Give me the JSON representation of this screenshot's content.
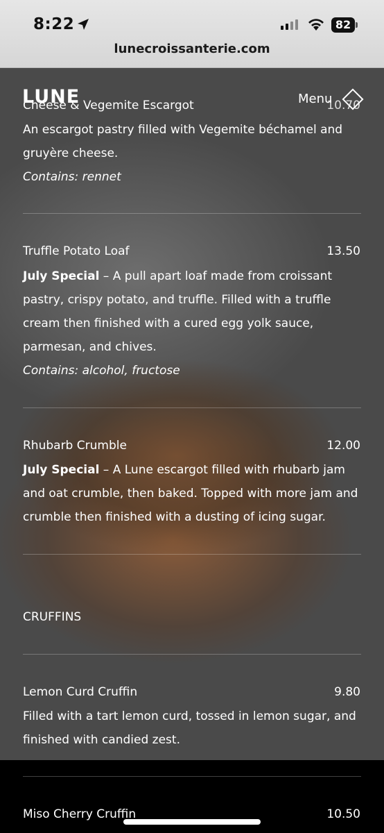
{
  "status_bar": {
    "time": "8:22",
    "battery": "82",
    "url": "lunecroissanterie.com"
  },
  "header": {
    "logo": "LUNE",
    "menu_label": "Menu"
  },
  "items": [
    {
      "name": "Cheese & Vegemite Escargot",
      "price": "10.70",
      "special": "",
      "description": "An escargot pastry filled with Vegemite béchamel and gruyère cheese.",
      "contains": "Contains: rennet"
    },
    {
      "name": "Truffle Potato Loaf",
      "price": "13.50",
      "special": "July Special",
      "description": " – A pull apart loaf made from croissant pastry, crispy potato, and truffle. Filled with a truffle cream then finished with a cured egg yolk sauce, parmesan, and chives.",
      "contains": "Contains: alcohol, fructose"
    },
    {
      "name": "Rhubarb Crumble",
      "price": "12.00",
      "special": "July Special",
      "description": " – A Lune escargot filled with rhubarb jam and oat crumble, then baked. Topped with more jam and crumble then finished with a dusting of icing sugar.",
      "contains": ""
    },
    {
      "name": "Lemon Curd Cruffin",
      "price": "9.80",
      "special": "",
      "description": "Filled with a tart lemon curd, tossed in lemon sugar, and finished with candied zest.",
      "contains": ""
    },
    {
      "name": "Miso Cherry Cruffin",
      "price": "10.50",
      "special": "",
      "description": "",
      "contains": ""
    }
  ],
  "sections": {
    "cruffins": "CRUFFINS"
  }
}
